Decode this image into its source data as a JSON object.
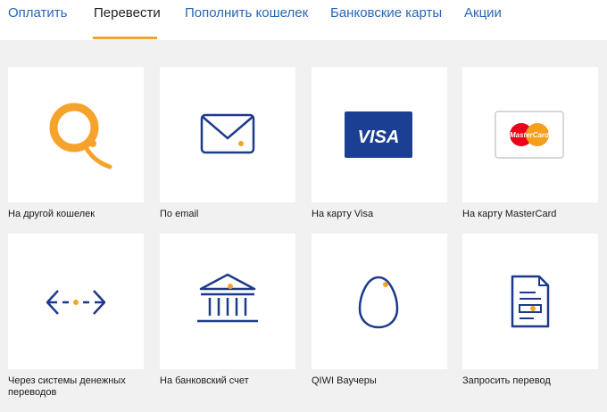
{
  "nav": {
    "tabs": [
      {
        "label": "Оплатить"
      },
      {
        "label": "Перевести"
      },
      {
        "label": "Пополнить кошелек"
      },
      {
        "label": "Банковские карты"
      },
      {
        "label": "Акции"
      }
    ],
    "active_tab": "Перевести"
  },
  "tiles": [
    {
      "label": "На другой кошелек",
      "icon": "qiwi-logo-icon"
    },
    {
      "label": "По email",
      "icon": "envelope-icon"
    },
    {
      "label": "На карту Visa",
      "icon": "visa-card-icon",
      "card_text": "VISA"
    },
    {
      "label": "На карту MasterCard",
      "icon": "mastercard-icon",
      "card_text": "MasterCard"
    },
    {
      "label": "Через системы денежных переводов",
      "icon": "transfer-arrows-icon"
    },
    {
      "label": "На банковский счет",
      "icon": "bank-icon"
    },
    {
      "label": "QIWI Ваучеры",
      "icon": "egg-icon"
    },
    {
      "label": "Запросить перевод",
      "icon": "document-icon"
    }
  ],
  "colors": {
    "link": "#2a66b5",
    "accent": "#f6a32c",
    "icon_stroke": "#1e3a8a",
    "visa_blue": "#1a3f93",
    "mastercard_red": "#eb001b",
    "mastercard_orange": "#f79e1b",
    "background": "#f1f1f1"
  }
}
